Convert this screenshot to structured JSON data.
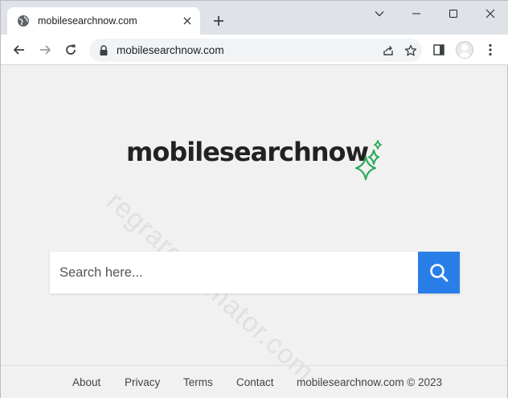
{
  "browser": {
    "tab_title": "mobilesearchnow.com",
    "tab_icon": "globe-icon",
    "new_tab_icon": "plus-icon",
    "url": "mobilesearchnow.com",
    "window_controls": [
      "chevron-down-icon",
      "minimize-icon",
      "maximize-icon",
      "close-icon"
    ],
    "nav_icons": [
      "back-arrow-icon",
      "forward-arrow-icon",
      "reload-icon"
    ],
    "toolbar_icons": [
      "share-icon",
      "bookmark-star-icon",
      "side-panel-icon",
      "profile-avatar-icon",
      "more-menu-icon"
    ]
  },
  "page": {
    "watermark": "regrareanimator.com",
    "logo_text": "mobilesearchnow",
    "logo_accent_color": "#2eaa5c",
    "search": {
      "placeholder": "Search here...",
      "button_icon": "search-icon",
      "button_color": "#2a7ee8"
    },
    "footer": {
      "about": "About",
      "privacy": "Privacy",
      "terms": "Terms",
      "contact": "Contact",
      "copyright": "mobilesearchnow.com © 2023"
    }
  }
}
